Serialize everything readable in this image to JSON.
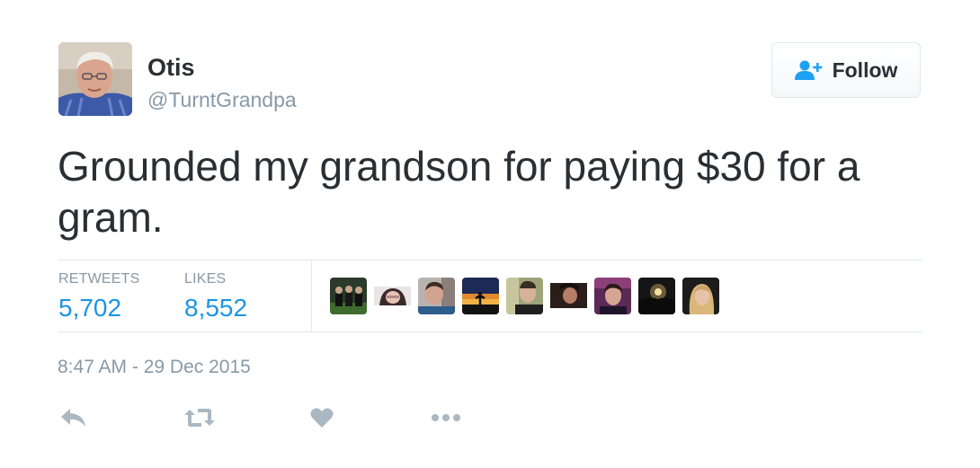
{
  "author": {
    "name": "Otis",
    "handle": "@TurntGrandpa",
    "avatar_icon": "elderly-man-avatar"
  },
  "follow_button": {
    "label": "Follow",
    "icon": "add-user-icon",
    "icon_color": "#1da1f2"
  },
  "tweet": {
    "text": "Grounded my grandson for paying $30 for a gram."
  },
  "stats": {
    "retweets_label": "RETWEETS",
    "retweets_value": "5,702",
    "likes_label": "LIKES",
    "likes_value": "8,552",
    "value_color": "#1b95e0"
  },
  "likers": [
    {
      "icon": "group-photo-avatar"
    },
    {
      "icon": "girl-portrait-avatar"
    },
    {
      "icon": "selfie-avatar"
    },
    {
      "icon": "sunset-silhouette-avatar"
    },
    {
      "icon": "boy-portrait-avatar"
    },
    {
      "icon": "dark-portrait-avatar"
    },
    {
      "icon": "purple-portrait-avatar"
    },
    {
      "icon": "sunset-landscape-avatar"
    },
    {
      "icon": "blonde-portrait-avatar"
    }
  ],
  "timestamp": "8:47 AM - 29 Dec 2015",
  "actions": {
    "reply_icon": "reply-icon",
    "retweet_icon": "retweet-icon",
    "like_icon": "heart-icon",
    "more_icon": "more-dots-icon",
    "icon_color": "#aab8c2"
  }
}
